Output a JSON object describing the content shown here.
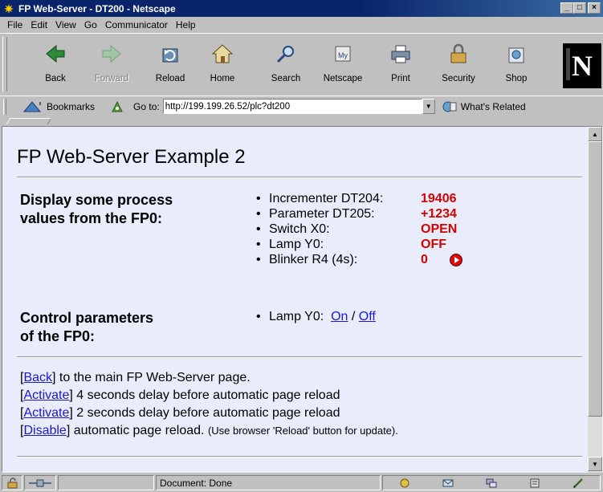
{
  "window": {
    "title": "FP Web-Server - DT200 - Netscape",
    "minimize": "_",
    "maximize": "□",
    "close": "×"
  },
  "menu": [
    "File",
    "Edit",
    "View",
    "Go",
    "Communicator",
    "Help"
  ],
  "toolbar": {
    "buttons": [
      {
        "label": "Back",
        "icon": "back-arrow-icon",
        "enabled": true
      },
      {
        "label": "Forward",
        "icon": "forward-arrow-icon",
        "enabled": false
      },
      {
        "label": "Reload",
        "icon": "reload-icon",
        "enabled": true
      },
      {
        "label": "Home",
        "icon": "home-icon",
        "enabled": true
      },
      {
        "label": "Search",
        "icon": "search-icon",
        "enabled": true
      },
      {
        "label": "Netscape",
        "icon": "my-netscape-icon",
        "enabled": true
      },
      {
        "label": "Print",
        "icon": "print-icon",
        "enabled": true
      },
      {
        "label": "Security",
        "icon": "lock-icon",
        "enabled": true
      },
      {
        "label": "Shop",
        "icon": "shop-icon",
        "enabled": true
      }
    ],
    "logo_letter": "N"
  },
  "location": {
    "bookmarks_label": "Bookmarks",
    "goto_label": "Go to:",
    "url": "http://199.199.26.52/plc?dt200",
    "whats_related": "What's Related"
  },
  "page": {
    "heading": "FP Web-Server Example 2",
    "display_title_1": "Display some process",
    "display_title_2": "values from the FP0:",
    "process_values": [
      {
        "label": "Incrementer DT204:",
        "value": "19406"
      },
      {
        "label": "Parameter  DT205:",
        "value": "+1234"
      },
      {
        "label": "Switch X0:",
        "value": "OPEN"
      },
      {
        "label": "Lamp   Y0:",
        "value": "OFF"
      },
      {
        "label": "Blinker R4 (4s):",
        "value": "0"
      }
    ],
    "control_title_1": "Control parameters",
    "control_title_2": "of the FP0:",
    "control": {
      "label": "Lamp Y0:",
      "on": "On",
      "separator": "/",
      "off": "Off"
    },
    "nav": [
      {
        "open": "[",
        "link": "Back",
        "close": "]",
        "text": " to the main FP Web-Server page.",
        "small": ""
      },
      {
        "open": "[",
        "link": "Activate",
        "close": "]",
        "text": " 4 seconds delay before automatic page reload",
        "small": ""
      },
      {
        "open": "[",
        "link": "Activate",
        "close": "]",
        "text": " 2 seconds delay before automatic page reload",
        "small": ""
      },
      {
        "open": "[",
        "link": "Disable",
        "close": "]",
        "text": " automatic page reload. ",
        "small": "(Use browser 'Reload' button for update)."
      }
    ]
  },
  "status": {
    "text": "Document: Done"
  },
  "colors": {
    "title_bar": "#0a246a",
    "page_background": "#e8ecfb",
    "value_red": "#d40000",
    "link_blue": "#1a1acc"
  }
}
